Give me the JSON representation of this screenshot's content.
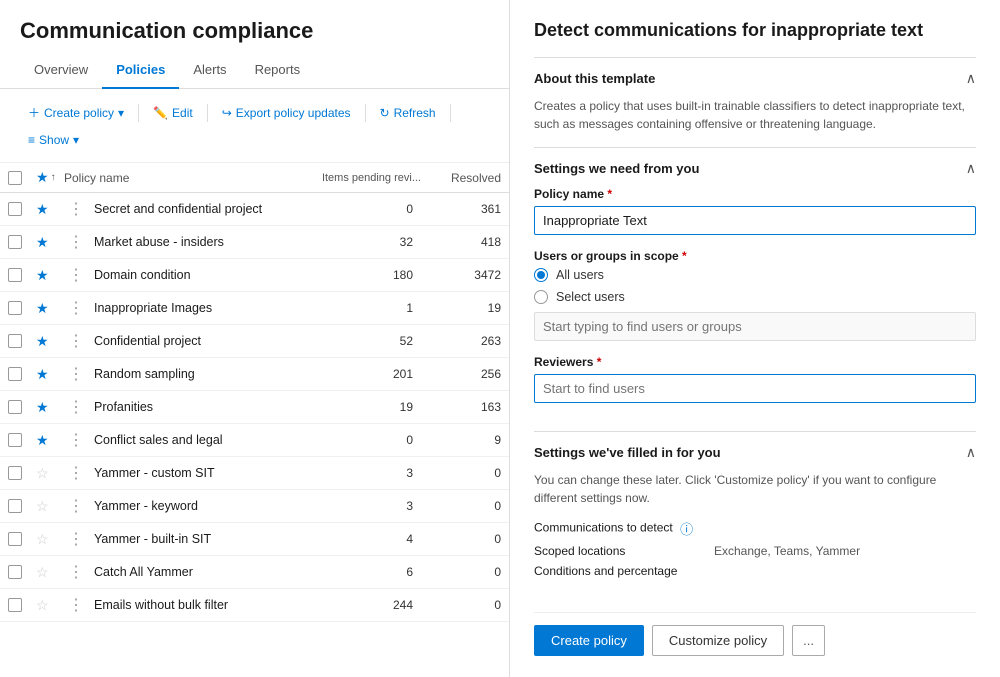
{
  "app": {
    "title": "Communication compliance"
  },
  "nav": {
    "tabs": [
      {
        "id": "overview",
        "label": "Overview",
        "active": false
      },
      {
        "id": "policies",
        "label": "Policies",
        "active": true
      },
      {
        "id": "alerts",
        "label": "Alerts",
        "active": false
      },
      {
        "id": "reports",
        "label": "Reports",
        "active": false
      }
    ]
  },
  "toolbar": {
    "create_label": "Create policy",
    "edit_label": "Edit",
    "export_label": "Export policy updates",
    "refresh_label": "Refresh",
    "show_label": "Show"
  },
  "table": {
    "columns": {
      "policy_name": "Policy name",
      "items_pending": "Items pending revi...",
      "resolved": "Resolved"
    },
    "rows": [
      {
        "starred": true,
        "name": "Secret and confidential project",
        "pending": 0,
        "resolved": 361
      },
      {
        "starred": true,
        "name": "Market abuse - insiders",
        "pending": 32,
        "resolved": 418
      },
      {
        "starred": true,
        "name": "Domain condition",
        "pending": 180,
        "resolved": 3472
      },
      {
        "starred": true,
        "name": "Inappropriate Images",
        "pending": 1,
        "resolved": 19
      },
      {
        "starred": true,
        "name": "Confidential project",
        "pending": 52,
        "resolved": 263
      },
      {
        "starred": true,
        "name": "Random sampling",
        "pending": 201,
        "resolved": 256
      },
      {
        "starred": true,
        "name": "Profanities",
        "pending": 19,
        "resolved": 163
      },
      {
        "starred": true,
        "name": "Conflict sales and legal",
        "pending": 0,
        "resolved": 9
      },
      {
        "starred": false,
        "name": "Yammer - custom SIT",
        "pending": 3,
        "resolved": 0
      },
      {
        "starred": false,
        "name": "Yammer - keyword",
        "pending": 3,
        "resolved": 0
      },
      {
        "starred": false,
        "name": "Yammer - built-in SIT",
        "pending": 4,
        "resolved": 0
      },
      {
        "starred": false,
        "name": "Catch All Yammer",
        "pending": 6,
        "resolved": 0
      },
      {
        "starred": false,
        "name": "Emails without bulk filter",
        "pending": 244,
        "resolved": 0
      }
    ]
  },
  "right_panel": {
    "title": "Detect communications for inappropriate text",
    "about_section": {
      "title": "About this template",
      "description": "Creates a policy that uses built-in trainable classifiers to detect inappropriate text, such as messages containing offensive or threatening language."
    },
    "settings_section": {
      "title": "Settings we need from you",
      "policy_name_label": "Policy name",
      "policy_name_value": "Inappropriate Text",
      "users_label": "Users or groups in scope",
      "radio_all_users": "All users",
      "radio_select_users": "Select users",
      "users_placeholder": "Start typing to find users or groups",
      "reviewers_label": "Reviewers",
      "reviewers_placeholder": "Start to find users"
    },
    "filled_section": {
      "title": "Settings we've filled in for you",
      "description": "You can change these later. Click 'Customize policy' if you want to configure different settings now.",
      "comms_label": "Communications to detect",
      "scoped_locations_label": "Scoped locations",
      "scoped_locations_value": "Exchange, Teams, Yammer",
      "conditions_label": "Conditions and percentage"
    },
    "buttons": {
      "create": "Create policy",
      "customize": "Customize policy",
      "more": "..."
    }
  }
}
